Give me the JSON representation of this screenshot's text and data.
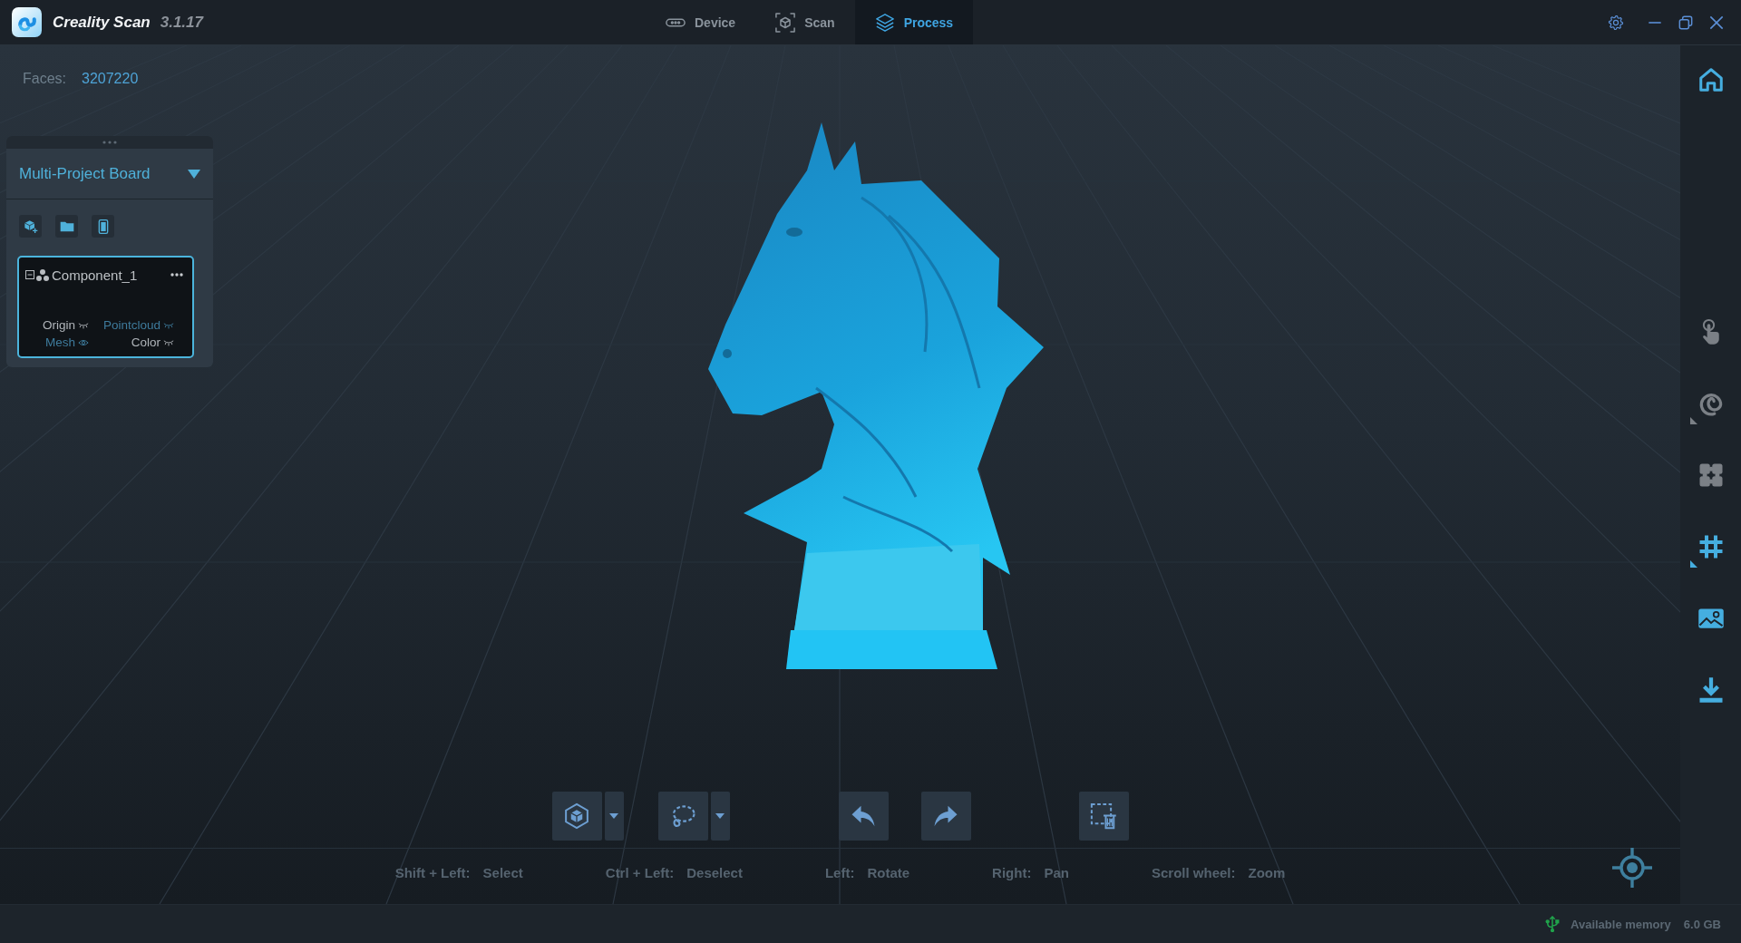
{
  "window": {
    "app_name": "Creality Scan",
    "version": "3.1.17"
  },
  "tabs": [
    {
      "label": "Device",
      "selected": false
    },
    {
      "label": "Scan",
      "selected": false
    },
    {
      "label": "Process",
      "selected": true
    }
  ],
  "viewport": {
    "faces_label": "Faces:",
    "faces_value": "3207220"
  },
  "project_board": {
    "title": "Multi-Project Board",
    "components": [
      {
        "name": "Component_1",
        "selected": true,
        "expanded": true,
        "layers": [
          {
            "label": "Origin",
            "available": false,
            "visible": false
          },
          {
            "label": "Pointcloud",
            "available": true,
            "visible": false
          },
          {
            "label": "Mesh",
            "available": true,
            "visible": true
          },
          {
            "label": "Color",
            "available": false,
            "visible": false
          }
        ]
      }
    ]
  },
  "hints": [
    {
      "keys": "Shift + Left:",
      "action": "Select"
    },
    {
      "keys": "Ctrl + Left:",
      "action": "Deselect"
    },
    {
      "keys": "Left:",
      "action": "Rotate"
    },
    {
      "keys": "Right:",
      "action": "Pan"
    },
    {
      "keys": "Scroll wheel:",
      "action": "Zoom"
    }
  ],
  "sidebar_tools": [
    {
      "disabled": false,
      "submenu": false
    },
    {
      "disabled": true,
      "submenu": false
    },
    {
      "disabled": true,
      "submenu": true
    },
    {
      "disabled": true,
      "submenu": false
    },
    {
      "disabled": false,
      "submenu": true
    },
    {
      "disabled": false,
      "submenu": false
    },
    {
      "disabled": false,
      "submenu": false
    }
  ],
  "status_bar": {
    "memory_label": "Available memory",
    "memory_value": "6.0 GB"
  }
}
